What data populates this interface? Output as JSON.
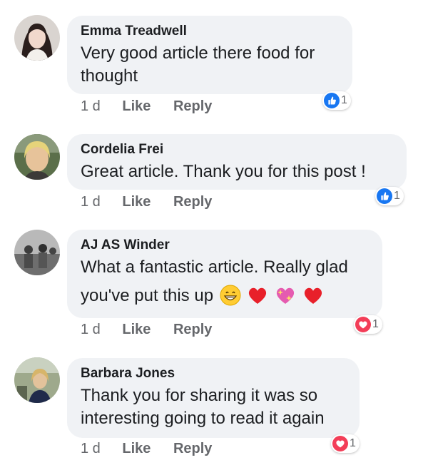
{
  "comments": [
    {
      "author": "Emma Treadwell",
      "text": "Very good article there food for thought",
      "time": "1 d",
      "like_label": "Like",
      "reply_label": "Reply",
      "reaction_icon": "like-icon",
      "reaction_count": "1"
    },
    {
      "author": "Cordelia Frei",
      "text": "Great article. Thank you for this post !",
      "time": "1 d",
      "like_label": "Like",
      "reply_label": "Reply",
      "reaction_icon": "like-icon",
      "reaction_count": "1"
    },
    {
      "author": "AJ AS Winder",
      "text_line1": "What a fantastic article. Really glad",
      "text_line2": "you've put this up",
      "emojis": [
        "grinning-face-emoji",
        "red-heart-emoji",
        "sparkling-heart-emoji",
        "red-heart-emoji"
      ],
      "time": "1 d",
      "like_label": "Like",
      "reply_label": "Reply",
      "reaction_icon": "love-icon",
      "reaction_count": "1"
    },
    {
      "author": "Barbara Jones",
      "text": "Thank you for sharing it was so interesting going to read it again",
      "time": "1 d",
      "like_label": "Like",
      "reply_label": "Reply",
      "reaction_icon": "love-icon",
      "reaction_count": "1"
    }
  ],
  "colors": {
    "bubble": "#f0f2f5",
    "meta_text": "#65676b",
    "like_blue": "#1877f2",
    "love_red": "#f33e58"
  }
}
